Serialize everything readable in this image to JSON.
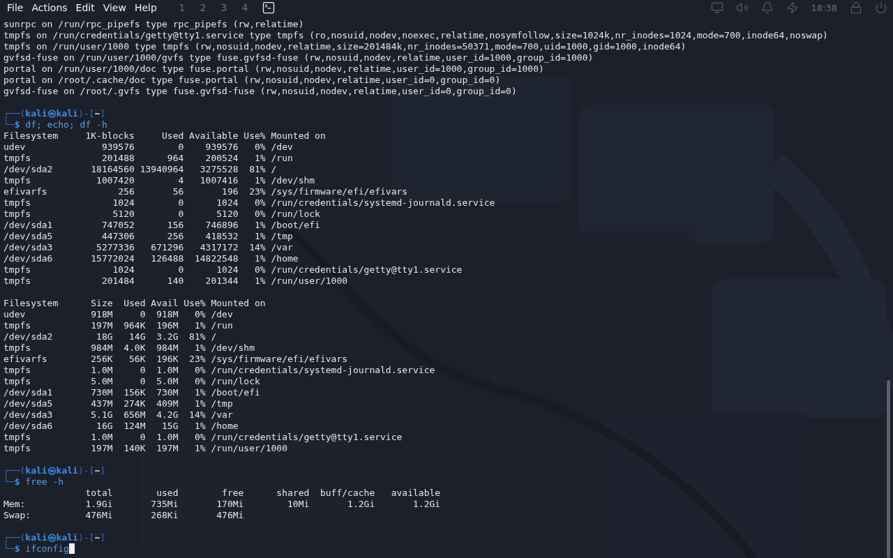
{
  "menu": [
    {
      "label": "File"
    },
    {
      "label": "Actions"
    },
    {
      "label": "Edit"
    },
    {
      "label": "View"
    },
    {
      "label": "Help"
    }
  ],
  "panel": {
    "workspaces": [
      "1",
      "2",
      "3",
      "4"
    ],
    "clock": "18:38"
  },
  "terminal": {
    "lines": [
      {
        "kind": "output",
        "text": "sunrpc on /run/rpc_pipefs type rpc_pipefs (rw,relatime)"
      },
      {
        "kind": "output",
        "text": "tmpfs on /run/credentials/getty@tty1.service type tmpfs (ro,nosuid,nodev,noexec,relatime,nosymfollow,size=1024k,nr_inodes=1024,mode=700,inode64,noswap)"
      },
      {
        "kind": "output",
        "text": "tmpfs on /run/user/1000 type tmpfs (rw,nosuid,nodev,relatime,size=201484k,nr_inodes=50371,mode=700,uid=1000,gid=1000,inode64)"
      },
      {
        "kind": "output",
        "text": "gvfsd-fuse on /run/user/1000/gvfs type fuse.gvfsd-fuse (rw,nosuid,nodev,relatime,user_id=1000,group_id=1000)"
      },
      {
        "kind": "output",
        "text": "portal on /run/user/1000/doc type fuse.portal (rw,nosuid,nodev,relatime,user_id=1000,group_id=1000)"
      },
      {
        "kind": "output",
        "text": "portal on /root/.cache/doc type fuse.portal (rw,nosuid,nodev,relatime,user_id=0,group_id=0)"
      },
      {
        "kind": "output",
        "text": "gvfsd-fuse on /root/.gvfs type fuse.gvfsd-fuse (rw,nosuid,nodev,relatime,user_id=0,group_id=0)"
      },
      {
        "kind": "blank"
      },
      {
        "kind": "prompt",
        "frame_open": "┌──(",
        "user": "kali㉿kali",
        "frame_mid": ")-[",
        "dir": "~",
        "frame_close": "]"
      },
      {
        "kind": "command",
        "corner": "└─",
        "sign": "$",
        "command": "df; echo; df -h",
        "cursor": false
      },
      {
        "kind": "output",
        "text": "Filesystem     1K-blocks     Used Available Use% Mounted on"
      },
      {
        "kind": "output",
        "text": "udev              939576        0    939576   0% /dev"
      },
      {
        "kind": "output",
        "text": "tmpfs             201488      964    200524   1% /run"
      },
      {
        "kind": "output",
        "text": "/dev/sda2       18164560 13940964   3275528  81% /"
      },
      {
        "kind": "output",
        "text": "tmpfs            1007420        4   1007416   1% /dev/shm"
      },
      {
        "kind": "output",
        "text": "efivarfs             256       56       196  23% /sys/firmware/efi/efivars"
      },
      {
        "kind": "output",
        "text": "tmpfs               1024        0      1024   0% /run/credentials/systemd-journald.service"
      },
      {
        "kind": "output",
        "text": "tmpfs               5120        0      5120   0% /run/lock"
      },
      {
        "kind": "output",
        "text": "/dev/sda1         747052      156    746896   1% /boot/efi"
      },
      {
        "kind": "output",
        "text": "/dev/sda5         447306      256    418532   1% /tmp"
      },
      {
        "kind": "output",
        "text": "/dev/sda3        5277336   671296   4317172  14% /var"
      },
      {
        "kind": "output",
        "text": "/dev/sda6       15772024   126488  14822548   1% /home"
      },
      {
        "kind": "output",
        "text": "tmpfs               1024        0      1024   0% /run/credentials/getty@tty1.service"
      },
      {
        "kind": "output",
        "text": "tmpfs             201484      140    201344   1% /run/user/1000"
      },
      {
        "kind": "blank"
      },
      {
        "kind": "output",
        "text": "Filesystem      Size  Used Avail Use% Mounted on"
      },
      {
        "kind": "output",
        "text": "udev            918M     0  918M   0% /dev"
      },
      {
        "kind": "output",
        "text": "tmpfs           197M  964K  196M   1% /run"
      },
      {
        "kind": "output",
        "text": "/dev/sda2        18G   14G  3.2G  81% /"
      },
      {
        "kind": "output",
        "text": "tmpfs           984M  4.0K  984M   1% /dev/shm"
      },
      {
        "kind": "output",
        "text": "efivarfs        256K   56K  196K  23% /sys/firmware/efi/efivars"
      },
      {
        "kind": "output",
        "text": "tmpfs           1.0M     0  1.0M   0% /run/credentials/systemd-journald.service"
      },
      {
        "kind": "output",
        "text": "tmpfs           5.0M     0  5.0M   0% /run/lock"
      },
      {
        "kind": "output",
        "text": "/dev/sda1       730M  156K  730M   1% /boot/efi"
      },
      {
        "kind": "output",
        "text": "/dev/sda5       437M  274K  409M   1% /tmp"
      },
      {
        "kind": "output",
        "text": "/dev/sda3       5.1G  656M  4.2G  14% /var"
      },
      {
        "kind": "output",
        "text": "/dev/sda6        16G  124M   15G   1% /home"
      },
      {
        "kind": "output",
        "text": "tmpfs           1.0M     0  1.0M   0% /run/credentials/getty@tty1.service"
      },
      {
        "kind": "output",
        "text": "tmpfs           197M  140K  197M   1% /run/user/1000"
      },
      {
        "kind": "blank"
      },
      {
        "kind": "prompt",
        "frame_open": "┌──(",
        "user": "kali㉿kali",
        "frame_mid": ")-[",
        "dir": "~",
        "frame_close": "]"
      },
      {
        "kind": "command",
        "corner": "└─",
        "sign": "$",
        "command": "free -h",
        "cursor": false
      },
      {
        "kind": "output",
        "text": "               total        used        free      shared  buff/cache   available"
      },
      {
        "kind": "output",
        "text": "Mem:           1.9Gi       735Mi       170Mi        10Mi       1.2Gi       1.2Gi"
      },
      {
        "kind": "output",
        "text": "Swap:          476Mi       268Ki       476Mi"
      },
      {
        "kind": "blank"
      },
      {
        "kind": "prompt",
        "frame_open": "┌──(",
        "user": "kali㉿kali",
        "frame_mid": ")-[",
        "dir": "~",
        "frame_close": "]"
      },
      {
        "kind": "command",
        "corner": "└─",
        "sign": "$",
        "command": "ifconfig",
        "cursor": true
      }
    ]
  }
}
